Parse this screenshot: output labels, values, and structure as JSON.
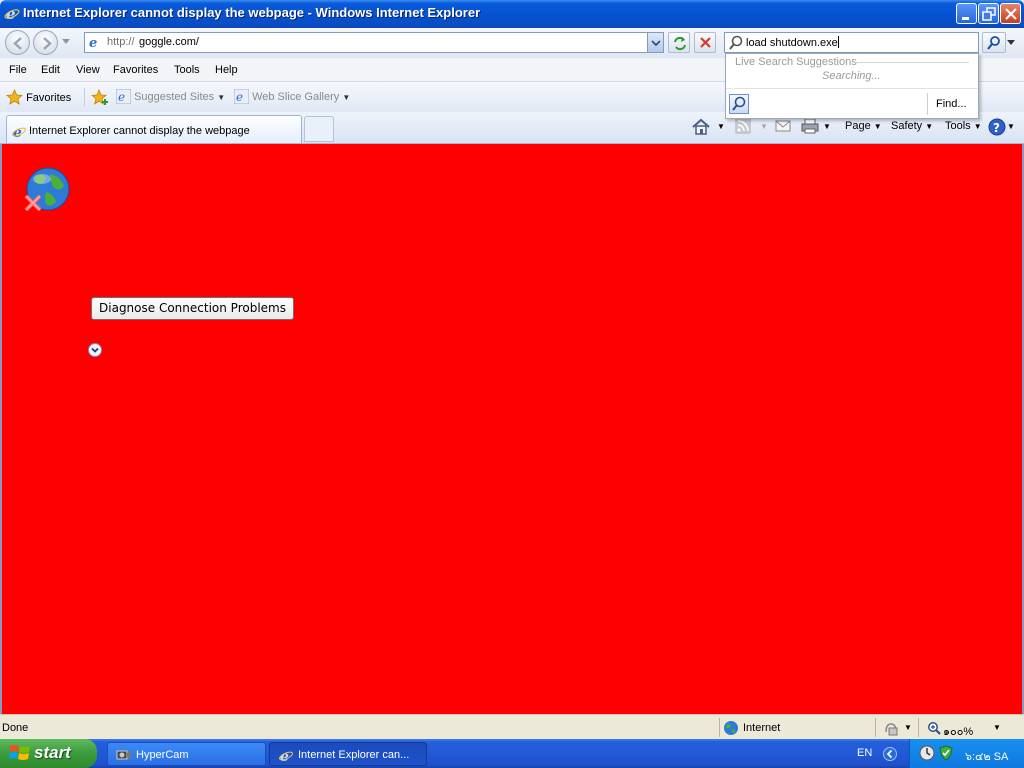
{
  "window": {
    "title": "Internet Explorer cannot display the webpage - Windows Internet Explorer"
  },
  "address": {
    "protocol": "http://",
    "host": "goggle.com/"
  },
  "search": {
    "value": "load shutdown.exe",
    "suggestions_header": "Live Search Suggestions",
    "searching": "Searching...",
    "find_label": "Find..."
  },
  "menu": {
    "items": [
      "File",
      "Edit",
      "View",
      "Favorites",
      "Tools",
      "Help"
    ]
  },
  "favorites_bar": {
    "favorites_label": "Favorites",
    "suggested_sites": "Suggested Sites",
    "web_slice_gallery": "Web Slice Gallery"
  },
  "tabs": {
    "active_label": "Internet Explorer cannot display the webpage"
  },
  "command_bar": {
    "page": "Page",
    "safety": "Safety",
    "tools": "Tools"
  },
  "page": {
    "diagnose_button": "Diagnose Connection Problems",
    "background_color": "#ff0000"
  },
  "status_bar": {
    "status": "Done",
    "zone": "Internet",
    "zoom": "๑๐๐%"
  },
  "taskbar": {
    "start_label": "start",
    "tasks": [
      "HyperCam",
      "Internet Explorer can..."
    ],
    "language": "EN",
    "clock": "๖:๔๒ SA"
  }
}
